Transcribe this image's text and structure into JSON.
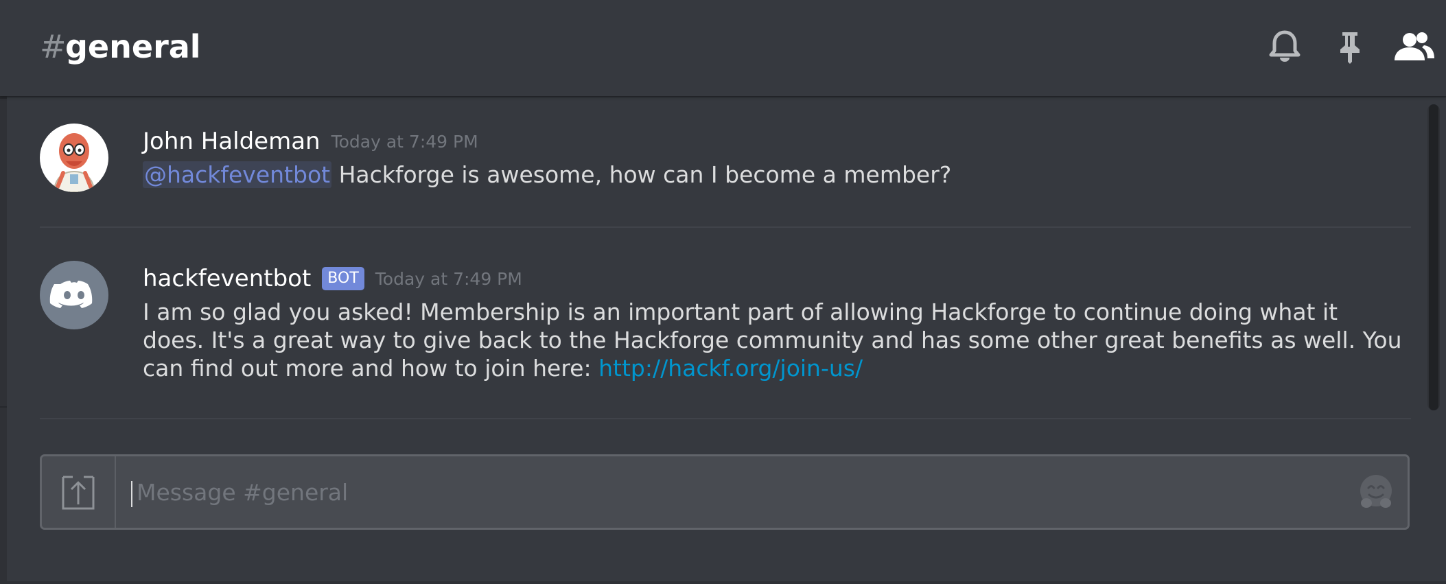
{
  "header": {
    "hash_symbol": "#",
    "channel_name": "general",
    "icons": [
      "bell-icon",
      "pin-icon",
      "members-icon"
    ]
  },
  "messages": [
    {
      "author": "John Haldeman",
      "timestamp": "Today at 7:49 PM",
      "avatar": "user-avatar",
      "mention": "@hackfeventbot",
      "text": " Hackforge is awesome, how can I become a member?"
    },
    {
      "author": "hackfeventbot",
      "bot_tag": "BOT",
      "timestamp": "Today at 7:49 PM",
      "avatar": "discord-logo-avatar",
      "text": "I am so glad you asked! Membership is an important part of allowing Hackforge to continue doing what it does. It's a great way to give back to the Hackforge community and has some other great benefits as well. You can find out more and how to join here: ",
      "link": "http://hackf.org/join-us/"
    }
  ],
  "composer": {
    "placeholder": "Message #general",
    "value": "",
    "icons": [
      "upload-icon",
      "emoji-icon"
    ]
  },
  "colors": {
    "background": "#36393f",
    "accent": "#7289da",
    "link": "#0096cf",
    "text": "#dcddde",
    "muted": "#72767d"
  }
}
